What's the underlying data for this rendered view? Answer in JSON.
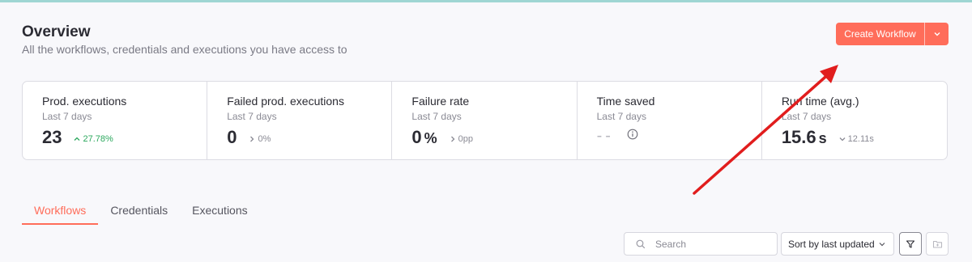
{
  "header": {
    "title": "Overview",
    "subtitle": "All the workflows, credentials and executions you have access to",
    "create_label": "Create Workflow"
  },
  "stats": [
    {
      "label": "Prod. executions",
      "period": "Last 7 days",
      "value": "23",
      "unit": "",
      "delta": "27.78%",
      "trend": "up"
    },
    {
      "label": "Failed prod. executions",
      "period": "Last 7 days",
      "value": "0",
      "unit": "",
      "delta": "0%",
      "trend": "neutral"
    },
    {
      "label": "Failure rate",
      "period": "Last 7 days",
      "value": "0",
      "unit": "%",
      "delta": "0pp",
      "trend": "neutral"
    },
    {
      "label": "Time saved",
      "period": "Last 7 days",
      "value": "--",
      "unit": "",
      "delta": "",
      "trend": "info"
    },
    {
      "label": "Run time (avg.)",
      "period": "Last 7 days",
      "value": "15.6",
      "unit": "s",
      "delta": "12.11s",
      "trend": "down"
    }
  ],
  "tabs": [
    {
      "label": "Workflows",
      "active": true
    },
    {
      "label": "Credentials",
      "active": false
    },
    {
      "label": "Executions",
      "active": false
    }
  ],
  "toolbar": {
    "search_placeholder": "Search",
    "sort_label": "Sort by last updated"
  },
  "colors": {
    "accent": "#ff6d5a",
    "positive": "#2ca85e",
    "annotation_arrow": "#e11d1d"
  },
  "icons": [
    "chevron-down-icon",
    "chevron-up-icon",
    "chevron-right-icon",
    "info-icon",
    "search-icon",
    "filter-icon",
    "folder-icon"
  ]
}
